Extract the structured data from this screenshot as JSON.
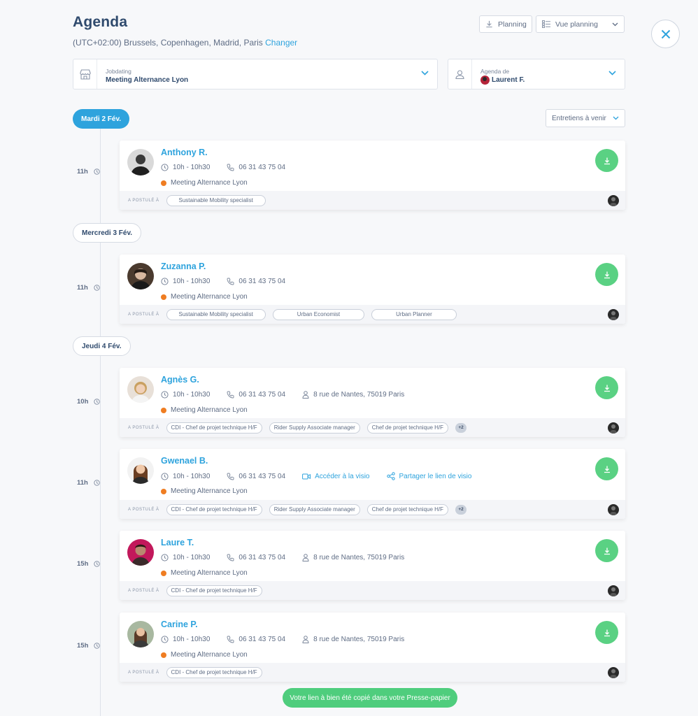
{
  "header": {
    "title": "Agenda",
    "timezone": "(UTC+02:00) Brussels, Copenhagen, Madrid, Paris",
    "change_link": "Changer",
    "planning_button": "Planning",
    "view_button": "Vue planning"
  },
  "filters": {
    "jobdating_label": "Jobdating",
    "jobdating_value": "Meeting Alternance  Lyon",
    "agenda_label": "Agenda de",
    "agenda_value": "Laurent F.",
    "upcoming_filter": "Entretiens à venir"
  },
  "labels": {
    "applied_to": "A POSTULÉ À"
  },
  "days": [
    {
      "label": "Mardi 2 Fév."
    },
    {
      "label": "Mercredi 3 Fév."
    },
    {
      "label": "Jeudi 4 Fév."
    }
  ],
  "interviews": [
    {
      "hour": "11h",
      "name": "Anthony R.",
      "time": "10h - 10h30",
      "phone": "06 31 43 75 04",
      "event": "Meeting Alternance  Lyon",
      "tags": [
        "Sustainable Mobility specialist"
      ]
    },
    {
      "hour": "11h",
      "name": "Zuzanna P.",
      "time": "10h - 10h30",
      "phone": "06 31 43 75 04",
      "event": "Meeting Alternance  Lyon",
      "tags": [
        "Sustainable Mobility specialist",
        "Urban Economist",
        "Urban Planner"
      ]
    },
    {
      "hour": "10h",
      "name": "Agnès G.",
      "time": "10h - 10h30",
      "phone": "06 31 43 75 04",
      "address": "8 rue de Nantes, 75019 Paris",
      "event": "Meeting Alternance  Lyon",
      "tags": [
        "CDI - Chef de projet technique H/F",
        "Rider Supply Associate manager",
        "Chef de projet technique H/F"
      ],
      "more": "+2"
    },
    {
      "hour": "11h",
      "name": "Gwenael B.",
      "time": "10h - 10h30",
      "phone": "06 31 43 75 04",
      "visio": "Accéder à la visio",
      "share": "Partager le lien de visio",
      "event": "Meeting Alternance  Lyon",
      "tags": [
        "CDI - Chef de projet technique H/F",
        "Rider Supply Associate manager",
        "Chef de projet technique H/F"
      ],
      "more": "+2"
    },
    {
      "hour": "15h",
      "name": "Laure T.",
      "time": "10h - 10h30",
      "phone": "06 31 43 75 04",
      "address": "8 rue de Nantes, 75019 Paris",
      "event": "Meeting Alternance  Lyon",
      "tags": [
        "CDI - Chef de projet technique H/F"
      ]
    },
    {
      "hour": "15h",
      "name": "Carine P.",
      "time": "10h - 10h30",
      "phone": "06 31 43 75 04",
      "address": "8 rue de Nantes, 75019 Paris",
      "event": "Meeting Alternance  Lyon",
      "tags": [
        "CDI - Chef de projet technique H/F"
      ]
    }
  ],
  "toast": "Votre lien à bien été copié dans votre Presse-papier",
  "colors": {
    "accent": "#2ea3dd",
    "success": "#5ad183",
    "event_dot": "#ef7d22",
    "title": "#2f4a6d"
  }
}
